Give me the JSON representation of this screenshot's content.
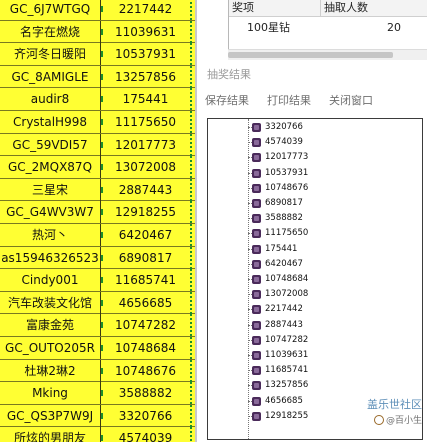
{
  "sheet": {
    "rows": [
      {
        "name": "GC_6J7WTGQ",
        "value": "2217442"
      },
      {
        "name": "名字在燃烧",
        "value": "11039631"
      },
      {
        "name": "齐河冬日暖阳",
        "value": "10537931"
      },
      {
        "name": "GC_8AMIGLE",
        "value": "13257856"
      },
      {
        "name": "audir8",
        "value": "175441"
      },
      {
        "name": "CrystalH998",
        "value": "11175650"
      },
      {
        "name": "GC_59VDI57",
        "value": "12017773"
      },
      {
        "name": "GC_2MQX87Q",
        "value": "13072008"
      },
      {
        "name": "三星宋",
        "value": "2887443"
      },
      {
        "name": "GC_G4WV3W7",
        "value": "12918255"
      },
      {
        "name": "热河丶",
        "value": "6420467"
      },
      {
        "name": "as15946326523",
        "value": "6890817"
      },
      {
        "name": "Cindy001",
        "value": "11685741"
      },
      {
        "name": "汽车改装文化馆",
        "value": "4656685"
      },
      {
        "name": "富康金苑",
        "value": "10747282"
      },
      {
        "name": "GC_OUTO205R",
        "value": "10748684"
      },
      {
        "name": "杜琳2琳2",
        "value": "10748676"
      },
      {
        "name": "Mking",
        "value": "3588882"
      },
      {
        "name": "GC_QS3P7W9J",
        "value": "3320766"
      },
      {
        "name": "所炫的男朋友",
        "value": "4574039"
      }
    ]
  },
  "prize_table": {
    "headers": [
      "奖项",
      "抽取人数"
    ],
    "rows": [
      {
        "prize": "100星钻",
        "count": "20"
      }
    ]
  },
  "result_window": {
    "title": "抽奖结果",
    "menu": [
      "保存结果",
      "打印结果",
      "关闭窗口"
    ],
    "results": [
      "3320766",
      "4574039",
      "12017773",
      "10537931",
      "10748676",
      "6890817",
      "3588882",
      "11175650",
      "175441",
      "6420467",
      "10748684",
      "13072008",
      "2217442",
      "2887443",
      "10747282",
      "11039631",
      "11685741",
      "13257856",
      "4656685",
      "12918255"
    ]
  },
  "watermark": {
    "line1": "盖乐世社区",
    "line2": "@百小生"
  },
  "colors": {
    "sheet_bg": "#ffff33",
    "tree_node": "#4a2a5a",
    "watermark": "#5e8fb8"
  }
}
